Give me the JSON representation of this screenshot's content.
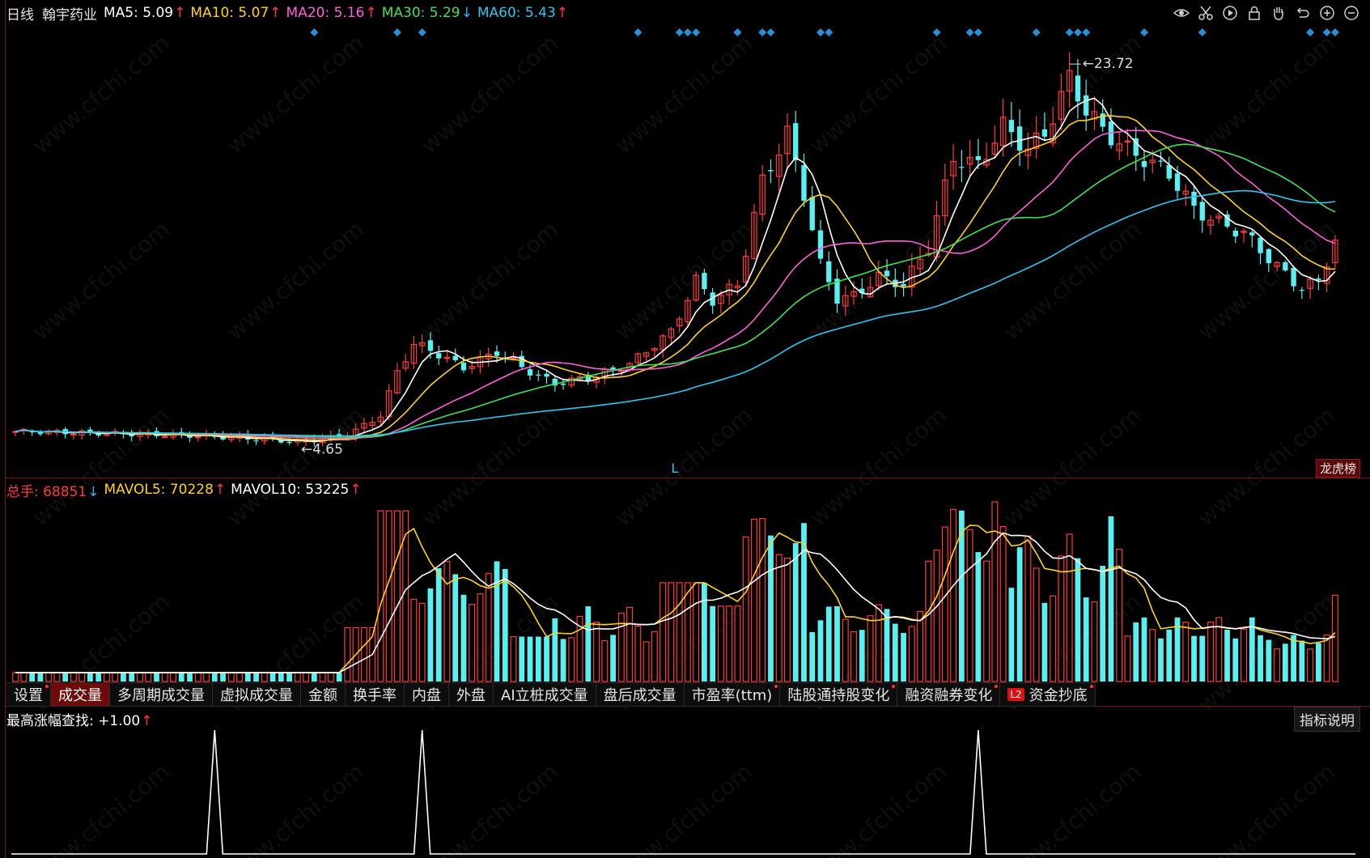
{
  "header": {
    "period": "日线",
    "stock_name": "翰宇药业",
    "ma": [
      {
        "label": "MA5: 5.09",
        "dir": "up",
        "color": "#ffffff"
      },
      {
        "label": "MA10: 5.07",
        "dir": "up",
        "color": "#ffd21f"
      },
      {
        "label": "MA20: 5.16",
        "dir": "up",
        "color": "#ff5fd7"
      },
      {
        "label": "MA30: 5.29",
        "dir": "down",
        "color": "#3fe15a"
      },
      {
        "label": "MA60: 5.43",
        "dir": "up",
        "color": "#2ec6ee"
      }
    ]
  },
  "toolbar_icons": [
    "eye-icon",
    "scissors-icon",
    "play-icon",
    "lock-icon",
    "hand-icon",
    "undo-icon",
    "zoom-in-icon",
    "zoom-out-icon"
  ],
  "price_chart": {
    "high_label": "23.72",
    "low_label": "4.65",
    "marker": "L",
    "rank_button": "龙虎榜"
  },
  "volume_header": {
    "total": "总手: 68851",
    "total_dir": "down",
    "mavol5": "MAVOL5: 70228",
    "mavol5_dir": "up",
    "mavol10": "MAVOL10: 53225",
    "mavol10_dir": "up"
  },
  "tabs": [
    {
      "label": "设置",
      "dot": true,
      "active": false
    },
    {
      "label": "成交量",
      "dot": false,
      "active": true
    },
    {
      "label": "多周期成交量",
      "dot": false,
      "active": false
    },
    {
      "label": "虚拟成交量",
      "dot": false,
      "active": false
    },
    {
      "label": "金额",
      "dot": false,
      "active": false
    },
    {
      "label": "换手率",
      "dot": false,
      "active": false
    },
    {
      "label": "内盘",
      "dot": false,
      "active": false
    },
    {
      "label": "外盘",
      "dot": false,
      "active": false
    },
    {
      "label": "AI立桩成交量",
      "dot": false,
      "active": false
    },
    {
      "label": "盘后成交量",
      "dot": false,
      "active": false
    },
    {
      "label": "市盈率(ttm)",
      "dot": true,
      "active": false
    },
    {
      "label": "陆股通持股变化",
      "dot": true,
      "active": false
    },
    {
      "label": "融资融券变化",
      "dot": true,
      "active": false
    },
    {
      "label": "资金抄底",
      "dot": true,
      "active": false,
      "badge": "L2"
    }
  ],
  "indicator": {
    "label": "最高涨幅查找: +1.00",
    "dir": "up",
    "help_button": "指标说明"
  },
  "colors": {
    "up": "#ff3b3b",
    "down": "#58f0f0",
    "ma5": "#ffffff",
    "ma10": "#ffd21f",
    "ma20": "#ff5fd7",
    "ma30": "#3fe15a",
    "ma60": "#2ec6ee",
    "signal": "#2a8fd6"
  },
  "watermark": "www.cfchi.com"
}
